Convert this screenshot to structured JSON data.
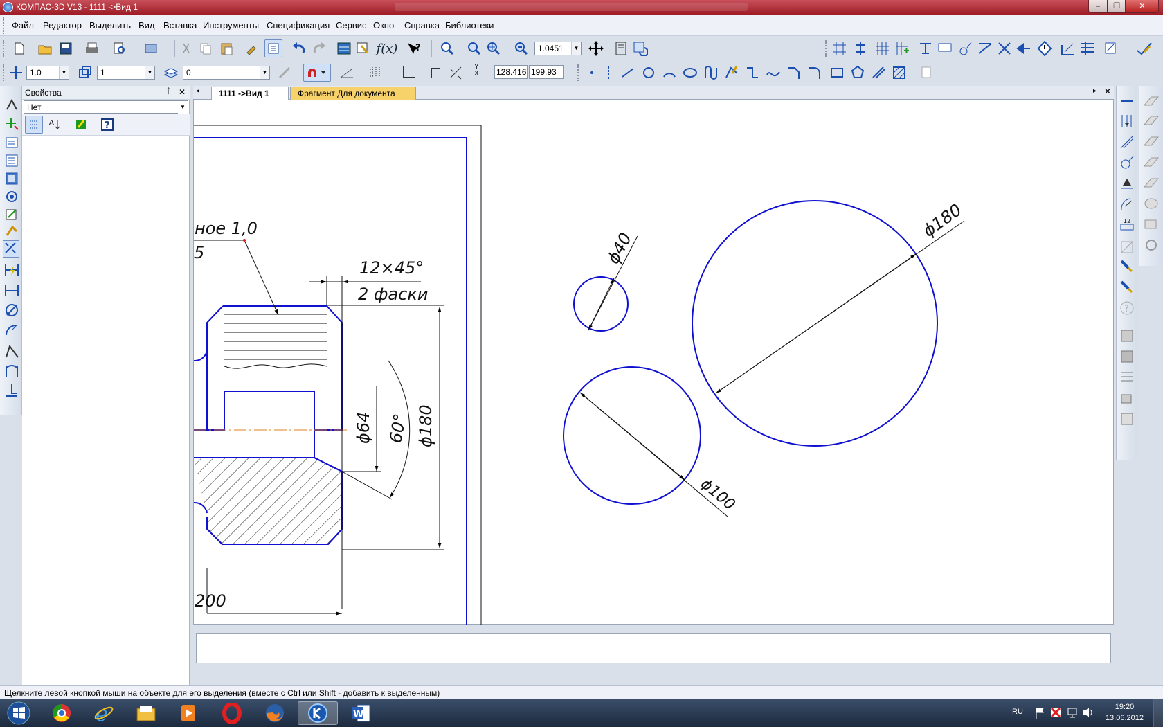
{
  "window": {
    "title": "КОМПАС-3D V13 - 1111 ->Вид 1",
    "minimize": "–",
    "restore": "❐",
    "close": "✕"
  },
  "menu": [
    "Файл",
    "Редактор",
    "Выделить",
    "Вид",
    "Вставка",
    "Инструменты",
    "Спецификация",
    "Сервис",
    "Окно",
    "Справка",
    "Библиотеки"
  ],
  "toolbar1": {
    "zoom_value": "1.0451"
  },
  "toolbar2": {
    "line_scale": "1.0",
    "layer": "1",
    "state": "0",
    "x_coord": "128.416",
    "y_coord": "199.93"
  },
  "properties_panel": {
    "title": "Свойства",
    "pin": "ф",
    "close": "✕",
    "dropdown": "Нет"
  },
  "tabs": [
    {
      "label": "1111 ->Вид 1"
    },
    {
      "label": "Фрагмент Для документа"
    }
  ],
  "drawing": {
    "labels": {
      "rough": "ное 1,0",
      "rough_prefix": "5",
      "chamfer": "12×45°",
      "chamfer_count": "2 фаски",
      "d64": "ϕ64",
      "angle": "60°",
      "d180_vert": "ϕ180",
      "len200": "200",
      "d40": "ϕ40",
      "d180": "ϕ180",
      "d100": "ϕ100"
    }
  },
  "status": {
    "hint": "Щелкните левой кнопкой мыши на объекте для его выделения (вместе с Ctrl или Shift - добавить к выделенным)"
  },
  "taskbar": {
    "apps": [
      "windows-start",
      "chrome",
      "internet-explorer",
      "file-explorer",
      "media-player",
      "opera",
      "firefox",
      "kompas-3d",
      "word"
    ],
    "lang": "RU",
    "time": "19:20",
    "date": "13.06.2012"
  }
}
